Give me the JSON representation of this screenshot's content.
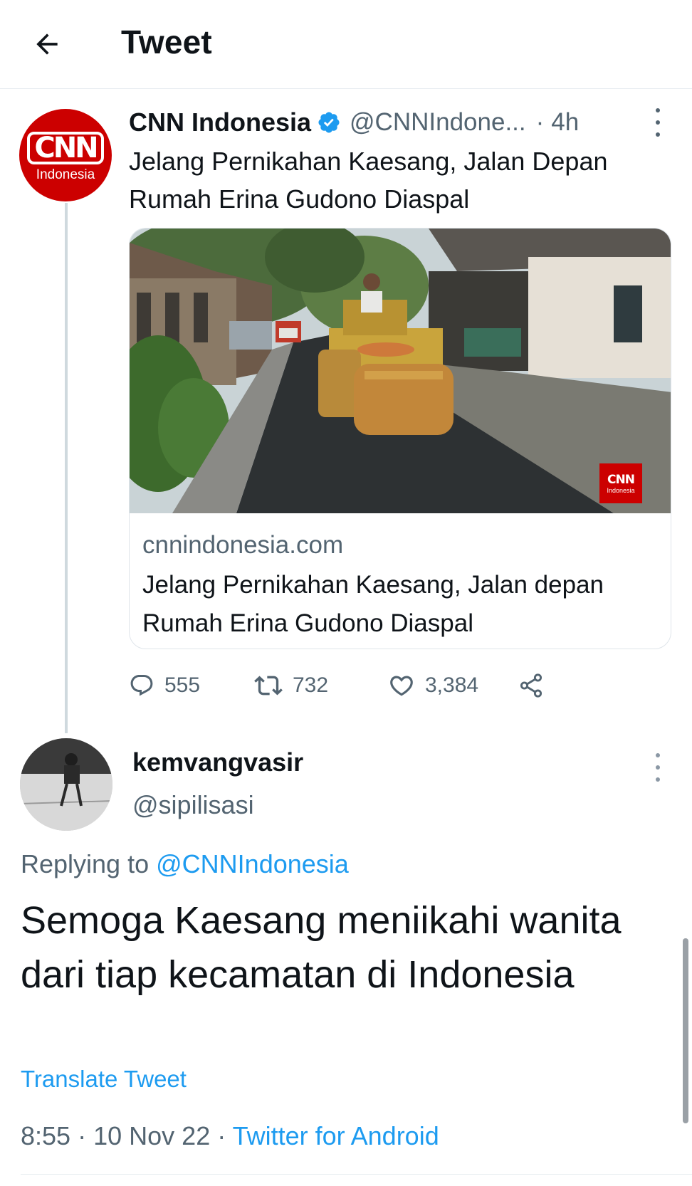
{
  "header": {
    "title": "Tweet",
    "back_icon": "arrow-left-icon"
  },
  "parent_tweet": {
    "avatar_logo": "CNN",
    "avatar_sub": "Indonesia",
    "name": "CNN Indonesia",
    "verified": true,
    "handle": "@CNNIndone...",
    "separator": "·",
    "time": "4h",
    "text": "Jelang Pernikahan Kaesang, Jalan Depan Rumah Erina Gudono Diaspal",
    "card": {
      "image_watermark_logo": "CNN",
      "image_watermark_sub": "Indonesia",
      "domain": "cnnindonesia.com",
      "title": "Jelang Pernikahan Kaesang, Jalan depan Rumah Erina Gudono Diaspal"
    },
    "actions": {
      "replies": "555",
      "retweets": "732",
      "likes": "3,384"
    }
  },
  "reply_tweet": {
    "name": "kemvangvasir",
    "handle": "@sipilisasi",
    "replying_prefix": "Replying to",
    "replying_to": "@CNNIndonesia",
    "text": "Semoga Kaesang meniikahi wanita dari tiap kecamatan di Indonesia",
    "translate": "Translate Tweet",
    "time": "8:55",
    "separator1": "·",
    "date": "10 Nov 22",
    "separator2": "·",
    "source": "Twitter for Android"
  },
  "colors": {
    "accent": "#1d9bf0",
    "text_primary": "#0f1419",
    "text_secondary": "#536471",
    "cnn_red": "#cc0000"
  }
}
